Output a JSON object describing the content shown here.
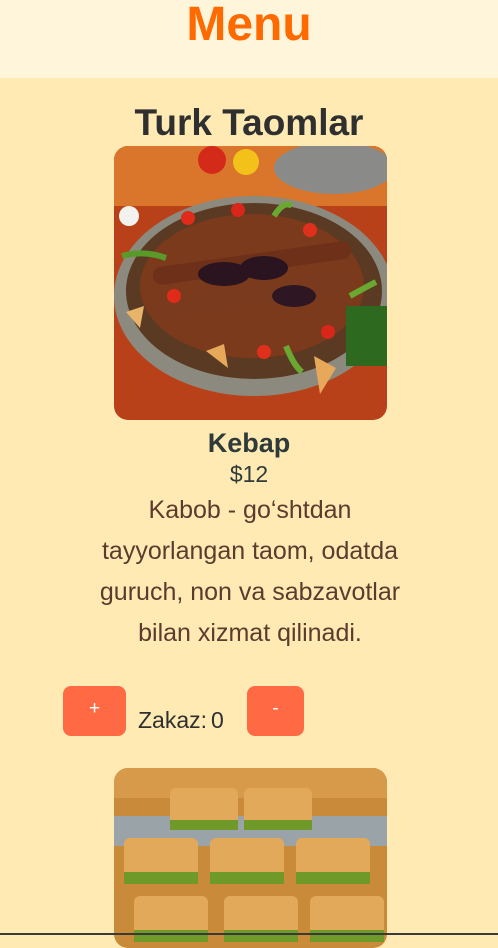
{
  "header": {
    "title": "Menu"
  },
  "section": {
    "title": "Turk Taomlar"
  },
  "dishes": [
    {
      "photo": "kebab-platter-photo",
      "name": "Kebap",
      "price": "$12",
      "description": "Kabob - go‘shtdan tayyorlangan taom, odatda guruch, non va sabzavotlar bilan xizmat qilinadi.",
      "plus_label": "+",
      "minus_label": "-",
      "order_label": "Zakaz:",
      "order_count": "0"
    },
    {
      "photo": "baklava-photo"
    }
  ],
  "colors": {
    "accent": "#ff6a00",
    "button": "#ff6a45",
    "background": "#ffeab3",
    "header_background": "#fff5da"
  }
}
